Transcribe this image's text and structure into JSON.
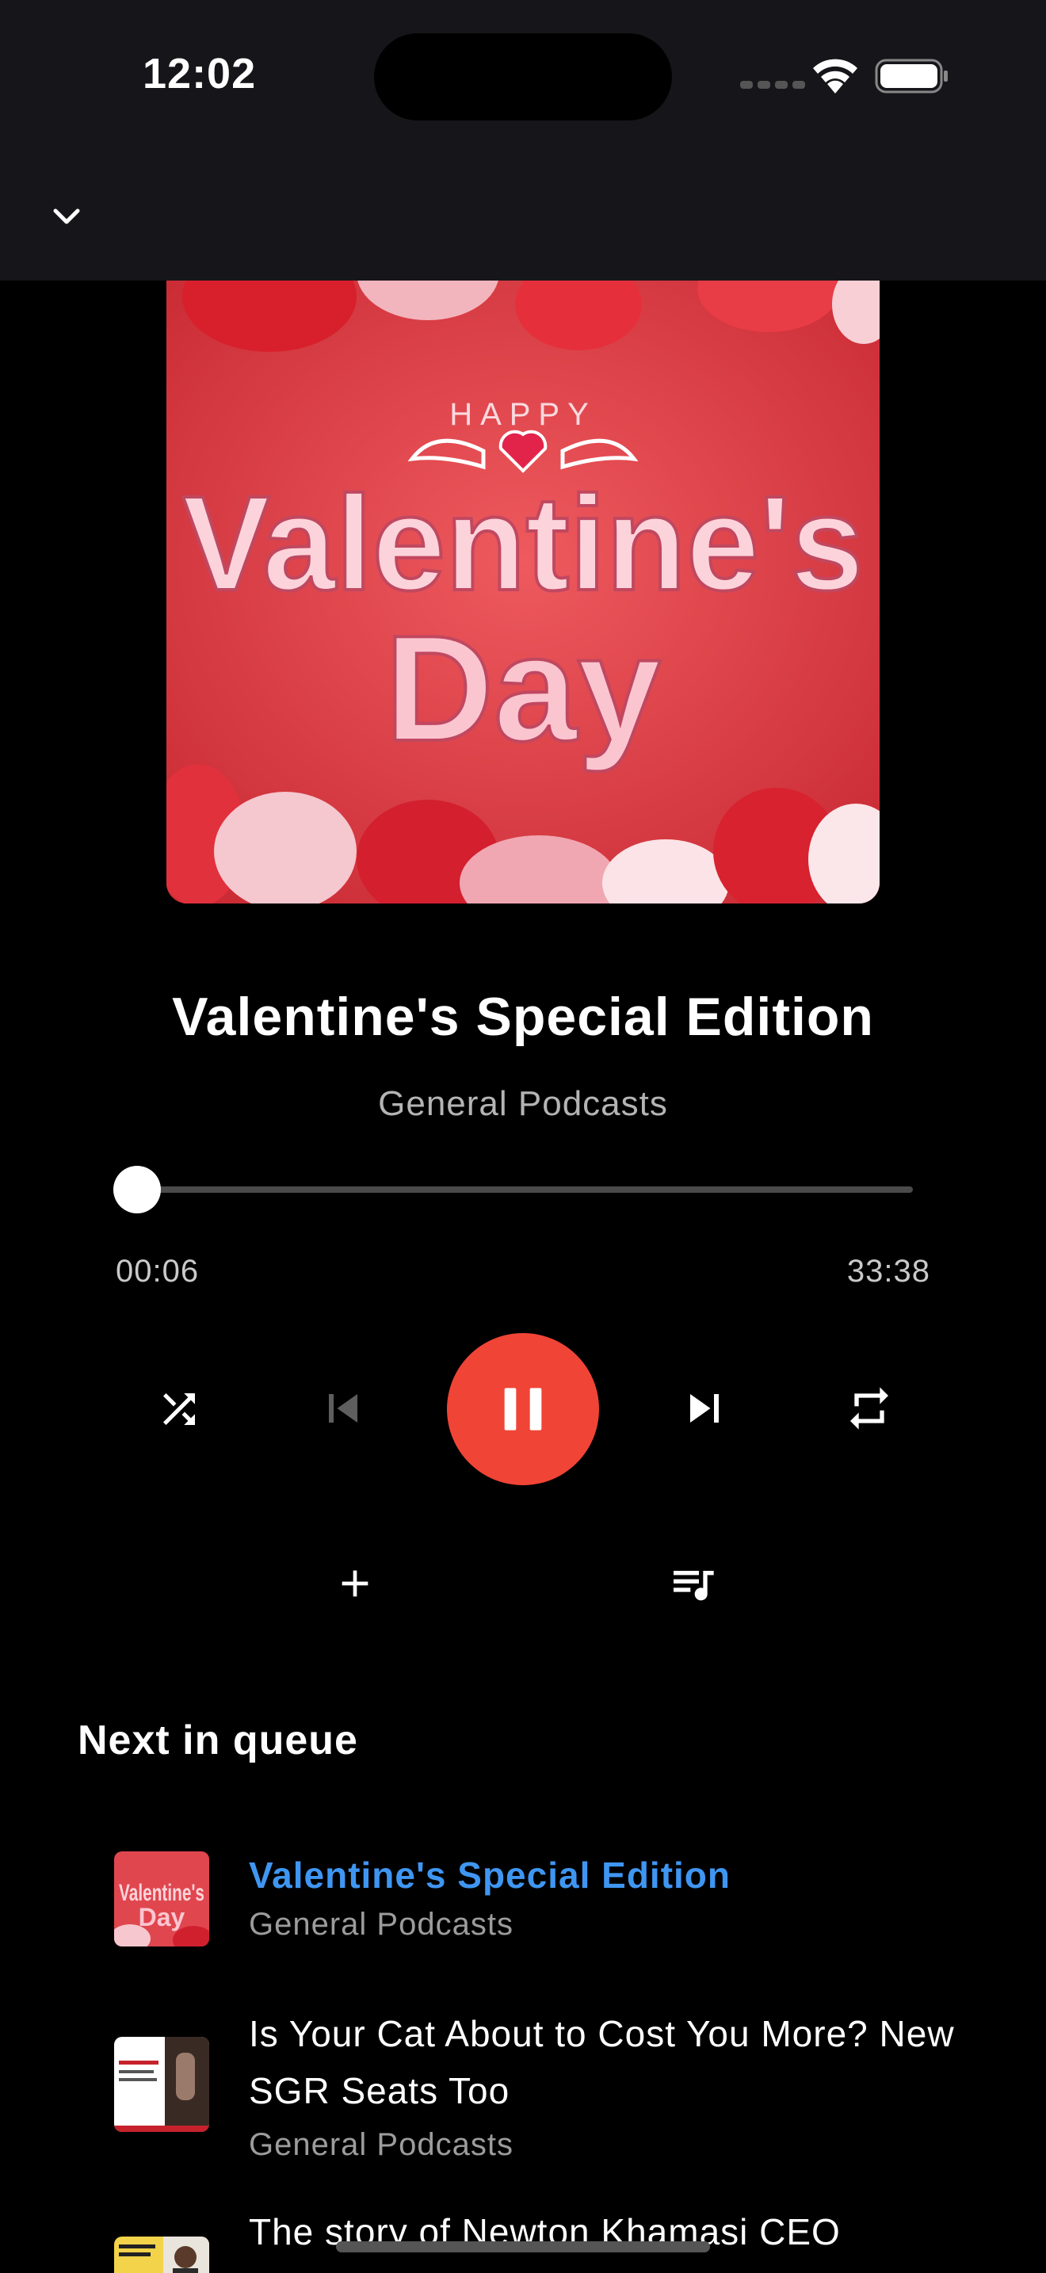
{
  "status_bar": {
    "time": "12:02"
  },
  "now_playing": {
    "title": "Valentine's Special Edition",
    "subtitle": "General Podcasts",
    "elapsed": "00:06",
    "total": "33:38",
    "progress": 0.003,
    "artwork": {
      "top_text": "HAPPY",
      "line1": "Valentine's",
      "line2": "Day"
    }
  },
  "controls": {
    "shuffle": "shuffle-icon",
    "previous": "skip-previous-icon",
    "play_pause": "pause-icon",
    "next": "skip-next-icon",
    "repeat": "repeat-icon",
    "add": "plus-icon",
    "queue": "queue-music-icon"
  },
  "queue": {
    "heading": "Next in queue",
    "items": [
      {
        "title": "Valentine's Special Edition",
        "subtitle": "General Podcasts",
        "active": true
      },
      {
        "title": "Is Your Cat About to Cost You More? New SGR Seats Too",
        "subtitle": "General Podcasts",
        "active": false
      },
      {
        "title": "The story of Newton Khamasi CEO",
        "subtitle": "",
        "active": false
      }
    ]
  },
  "colors": {
    "accent": "#f04436",
    "active_title": "#3f96f2",
    "background": "#000000",
    "header": "#16161a"
  }
}
